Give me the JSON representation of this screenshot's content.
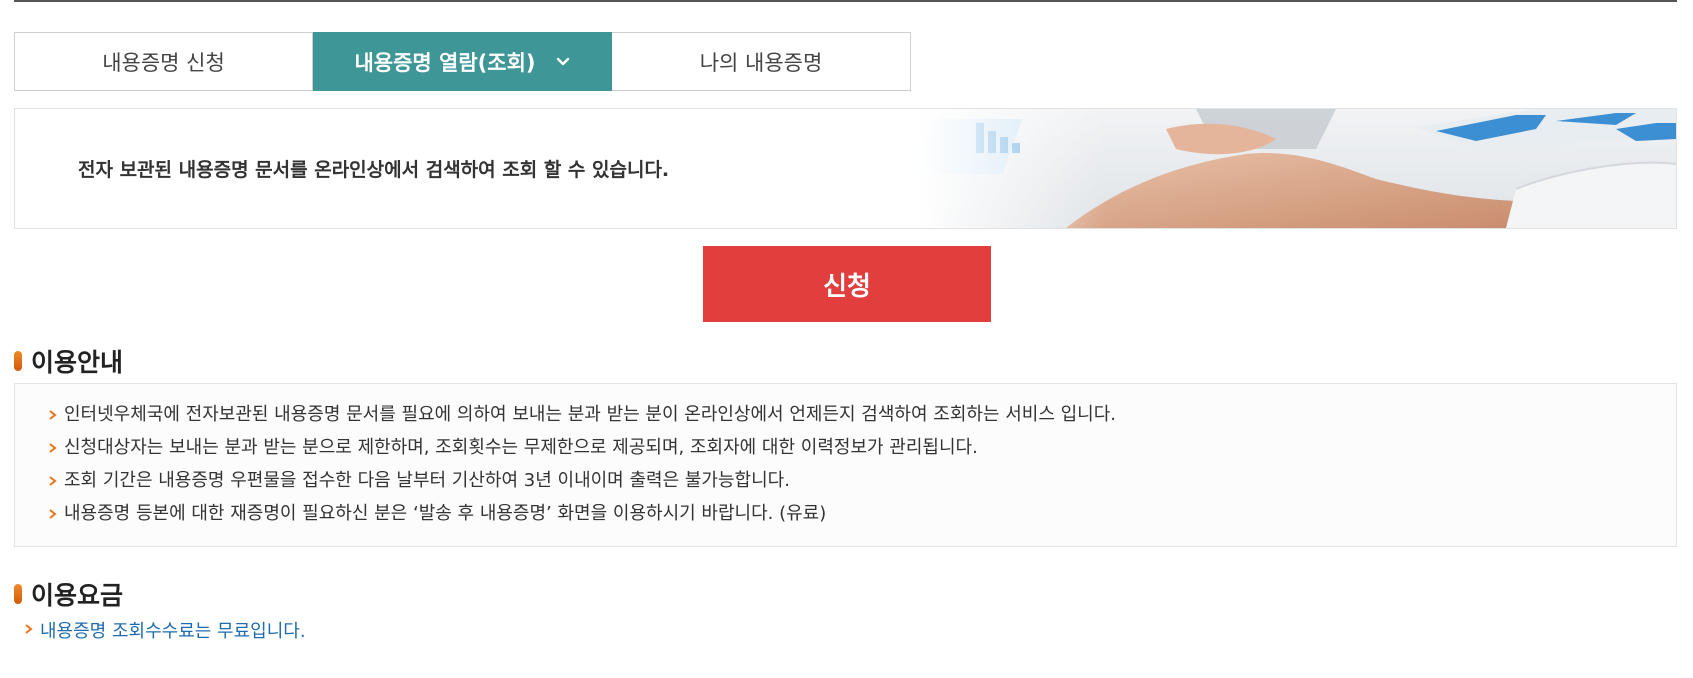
{
  "tabs": [
    {
      "label": "내용증명 신청",
      "active": false
    },
    {
      "label": "내용증명 열람(조회)",
      "active": true,
      "icon": "chevron-down-icon"
    },
    {
      "label": "나의 내용증명",
      "active": false
    }
  ],
  "banner": {
    "text": "전자 보관된 내용증명 문서를 온라인상에서 검색하여 조회 할 수 있습니다."
  },
  "apply_button": {
    "label": "신청",
    "color": "#e23e3e"
  },
  "usage_guide": {
    "title": "이용안내",
    "items": [
      "인터넷우체국에 전자보관된 내용증명 문서를 필요에 의하여 보내는 분과 받는 분이 온라인상에서 언제든지 검색하여 조회하는 서비스 입니다.",
      "신청대상자는 보내는 분과 받는 분으로 제한하며, 조회횟수는 무제한으로 제공되며, 조회자에 대한 이력정보가 관리됩니다.",
      "조회 기간은 내용증명 우편물을 접수한 다음 날부터 기산하여 3년 이내이며 출력은 불가능합니다.",
      "내용증명 등본에 대한 재증명이 필요하신 분은 ‘발송 후 내용증명’ 화면을 이용하시기 바랍니다. (유료)"
    ]
  },
  "usage_fee": {
    "title": "이용요금",
    "text": "내용증명 조회수수료는 무료입니다."
  },
  "colors": {
    "accent": "#3e9696",
    "button": "#e23e3e",
    "fee_text": "#1f6bb0",
    "bullet": "#e8741c"
  }
}
